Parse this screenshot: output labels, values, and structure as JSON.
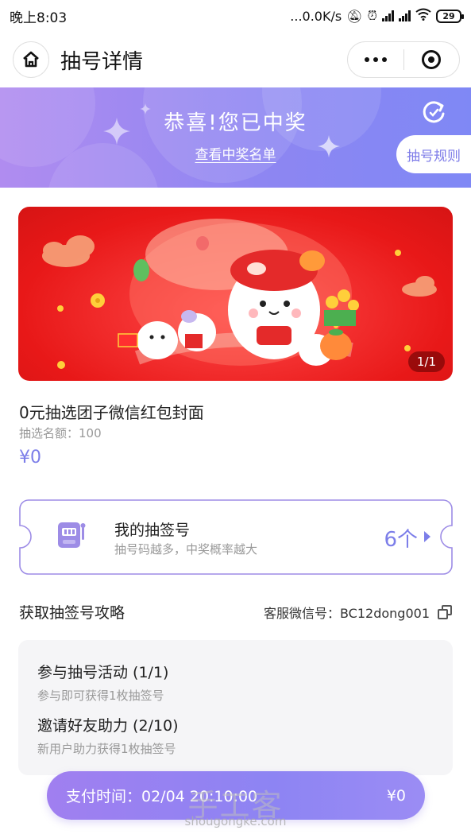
{
  "status_bar": {
    "time": "晚上8:03",
    "network": "...0.0K/s",
    "battery": "29"
  },
  "nav": {
    "title": "抽号详情"
  },
  "banner": {
    "title": "恭喜!您已中奖",
    "link": "查看中奖名单",
    "rules_label": "抽号规则"
  },
  "product": {
    "image_counter": "1/1",
    "title": "0元抽选团子微信红包封面",
    "quota": "抽选名额：100",
    "price": "¥0"
  },
  "ticket": {
    "title": "我的抽签号",
    "subtitle": "抽号码越多，中奖概率越大",
    "count": "6个"
  },
  "strategy": {
    "title": "获取抽签号攻略",
    "service": "客服微信号：BC12dong001"
  },
  "tasks": [
    {
      "title": "参与抽号活动 (1/1)",
      "desc": "参与即可获得1枚抽签号"
    },
    {
      "title": "邀请好友助力 (2/10)",
      "desc": "新用户助力获得1枚抽签号"
    }
  ],
  "pay_bar": {
    "time_label": "支付时间：02/04 20:10:00",
    "amount": "¥0"
  },
  "watermark": {
    "text": "手工客",
    "url": "shougongke.com"
  },
  "colors": {
    "accent": "#7c7ee9",
    "banner_start": "#b08cf0",
    "banner_end": "#7f88f5",
    "image_red": "#e81818"
  }
}
